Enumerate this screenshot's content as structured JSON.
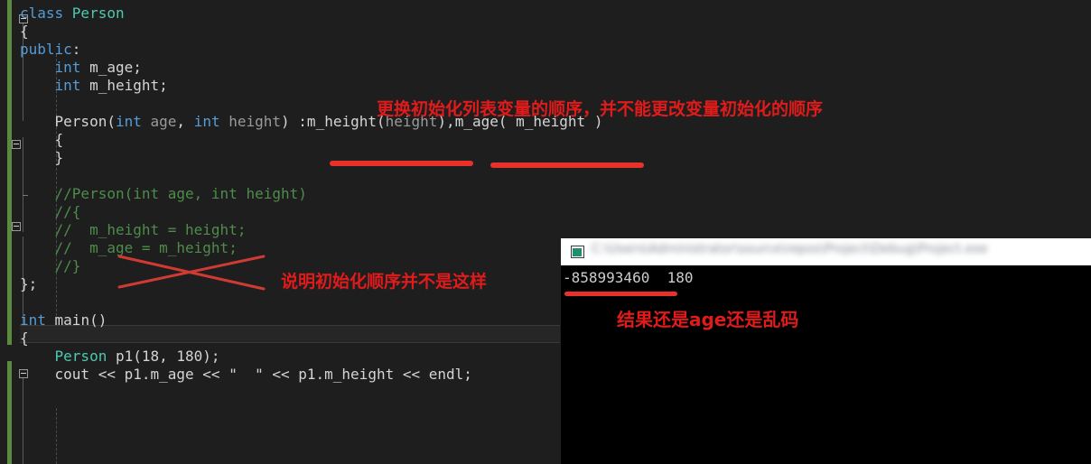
{
  "editor": {
    "background": "#1e1e1e",
    "lines": [
      {
        "indent": 0,
        "segments": [
          {
            "t": "class ",
            "c": "kw"
          },
          {
            "t": "Person",
            "c": "type"
          }
        ]
      },
      {
        "indent": 0,
        "segments": [
          {
            "t": "{",
            "c": "plain"
          }
        ]
      },
      {
        "indent": 0,
        "segments": [
          {
            "t": "public",
            "c": "kw"
          },
          {
            "t": ":",
            "c": "plain"
          }
        ]
      },
      {
        "indent": 0,
        "segments": [
          {
            "t": "    ",
            "c": "plain"
          },
          {
            "t": "int",
            "c": "kw"
          },
          {
            "t": " m_age;",
            "c": "id"
          }
        ]
      },
      {
        "indent": 0,
        "segments": [
          {
            "t": "    ",
            "c": "plain"
          },
          {
            "t": "int",
            "c": "kw"
          },
          {
            "t": " m_height;",
            "c": "id"
          }
        ]
      },
      {
        "indent": 0,
        "segments": [
          {
            "t": "",
            "c": "plain"
          }
        ]
      },
      {
        "indent": 0,
        "segments": [
          {
            "t": "    Person(",
            "c": "id"
          },
          {
            "t": "int",
            "c": "kw"
          },
          {
            "t": " ",
            "c": "plain"
          },
          {
            "t": "age",
            "c": "param"
          },
          {
            "t": ", ",
            "c": "id"
          },
          {
            "t": "int",
            "c": "kw"
          },
          {
            "t": " ",
            "c": "plain"
          },
          {
            "t": "height",
            "c": "param"
          },
          {
            "t": ") :m_height(",
            "c": "id"
          },
          {
            "t": "height",
            "c": "param"
          },
          {
            "t": "),m_age( m_height )",
            "c": "id"
          }
        ]
      },
      {
        "indent": 0,
        "segments": [
          {
            "t": "    {",
            "c": "plain"
          }
        ]
      },
      {
        "indent": 0,
        "segments": [
          {
            "t": "    }",
            "c": "plain"
          }
        ]
      },
      {
        "indent": 0,
        "segments": [
          {
            "t": "",
            "c": "plain"
          }
        ]
      },
      {
        "indent": 0,
        "segments": [
          {
            "t": "    //Person(int age, int height)",
            "c": "cmt"
          }
        ]
      },
      {
        "indent": 0,
        "segments": [
          {
            "t": "    //{",
            "c": "cmt"
          }
        ]
      },
      {
        "indent": 0,
        "segments": [
          {
            "t": "    //  m_height = height;",
            "c": "cmt"
          }
        ]
      },
      {
        "indent": 0,
        "segments": [
          {
            "t": "    //  m_age = m_height;",
            "c": "cmt"
          }
        ]
      },
      {
        "indent": 0,
        "segments": [
          {
            "t": "    //}",
            "c": "cmt"
          }
        ]
      },
      {
        "indent": 0,
        "segments": [
          {
            "t": "};",
            "c": "plain"
          }
        ]
      },
      {
        "indent": 0,
        "segments": [
          {
            "t": "",
            "c": "plain"
          }
        ]
      },
      {
        "indent": 0,
        "segments": [
          {
            "t": "int",
            "c": "kw"
          },
          {
            "t": " main()",
            "c": "id"
          }
        ]
      },
      {
        "indent": 0,
        "segments": [
          {
            "t": "{",
            "c": "plain"
          }
        ]
      },
      {
        "indent": 0,
        "segments": [
          {
            "t": "    ",
            "c": "plain"
          },
          {
            "t": "Person",
            "c": "type"
          },
          {
            "t": " p1(18, 180);",
            "c": "id"
          }
        ]
      },
      {
        "indent": 0,
        "segments": [
          {
            "t": "    cout << p1.m_age << ",
            "c": "id"
          },
          {
            "t": "\"  \"",
            "c": "plain"
          },
          {
            "t": " << p1.m_height << endl;",
            "c": "id"
          }
        ]
      }
    ]
  },
  "annotations": {
    "note_top": "更换初始化列表变量的顺序，并不能更改变量初始化的顺序",
    "note_mid": "说明初始化顺序并不是这样",
    "note_console": "结果还是age还是乱码",
    "accent_red": "#e8312a",
    "text_red": "#e01b1b"
  },
  "console": {
    "title_blurred": "C:\\Users\\Administrator\\source\\repos\\Project\\Debug\\Project.exe",
    "icon": "console-app-icon",
    "output": "-858993460  180"
  }
}
